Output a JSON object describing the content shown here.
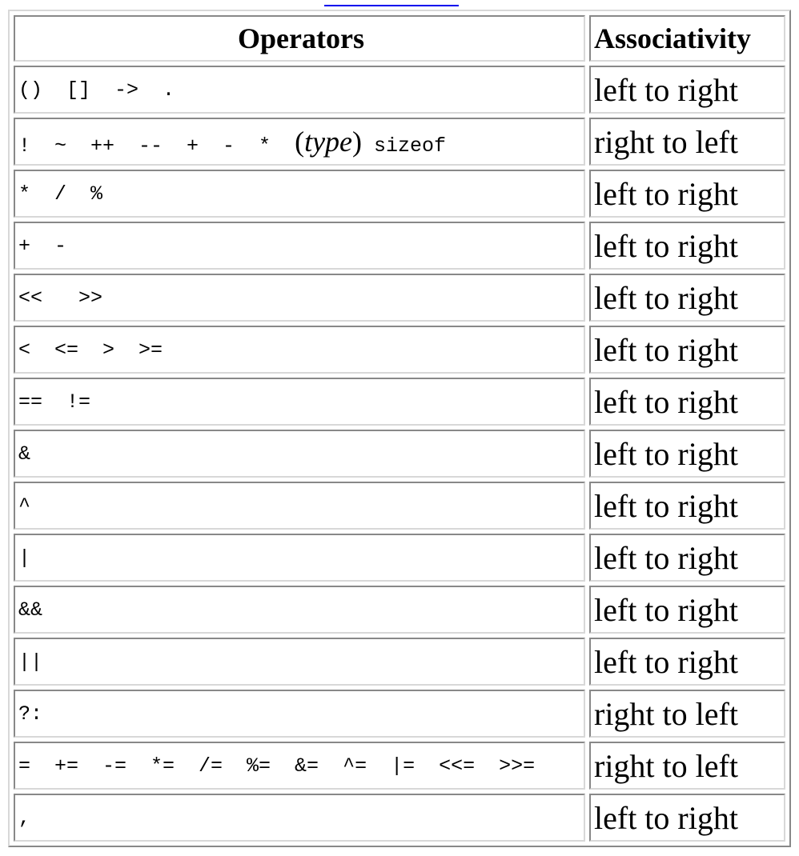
{
  "table": {
    "headers": {
      "operators": "Operators",
      "associativity": "Associativity"
    },
    "rows": [
      {
        "operators": "()  []  ->  .",
        "associativity": "left to right"
      },
      {
        "operators_prefix": "!  ~  ++  --  +  -  *  ",
        "operators_paren_open": "(",
        "operators_type": "type",
        "operators_paren_close": ")",
        "operators_suffix": " sizeof",
        "associativity": "right to left"
      },
      {
        "operators": "*  /  %",
        "associativity": "left to right"
      },
      {
        "operators": "+  -",
        "associativity": "left to right"
      },
      {
        "operators": "<<   >>",
        "associativity": "left to right"
      },
      {
        "operators": "<  <=  >  >=",
        "associativity": "left to right"
      },
      {
        "operators": "==  !=",
        "associativity": "left to right"
      },
      {
        "operators": "&",
        "associativity": "left to right"
      },
      {
        "operators": "^",
        "associativity": "left to right"
      },
      {
        "operators": "|",
        "associativity": "left to right"
      },
      {
        "operators": "&&",
        "associativity": "left to right"
      },
      {
        "operators": "||",
        "associativity": "left to right"
      },
      {
        "operators": "?:",
        "associativity": "right to left"
      },
      {
        "operators": "=  +=  -=  *=  /=  %=  &=  ^=  |=  <<=  >>=",
        "associativity": "right to left"
      },
      {
        "operators": ",",
        "associativity": "left to right"
      }
    ]
  }
}
